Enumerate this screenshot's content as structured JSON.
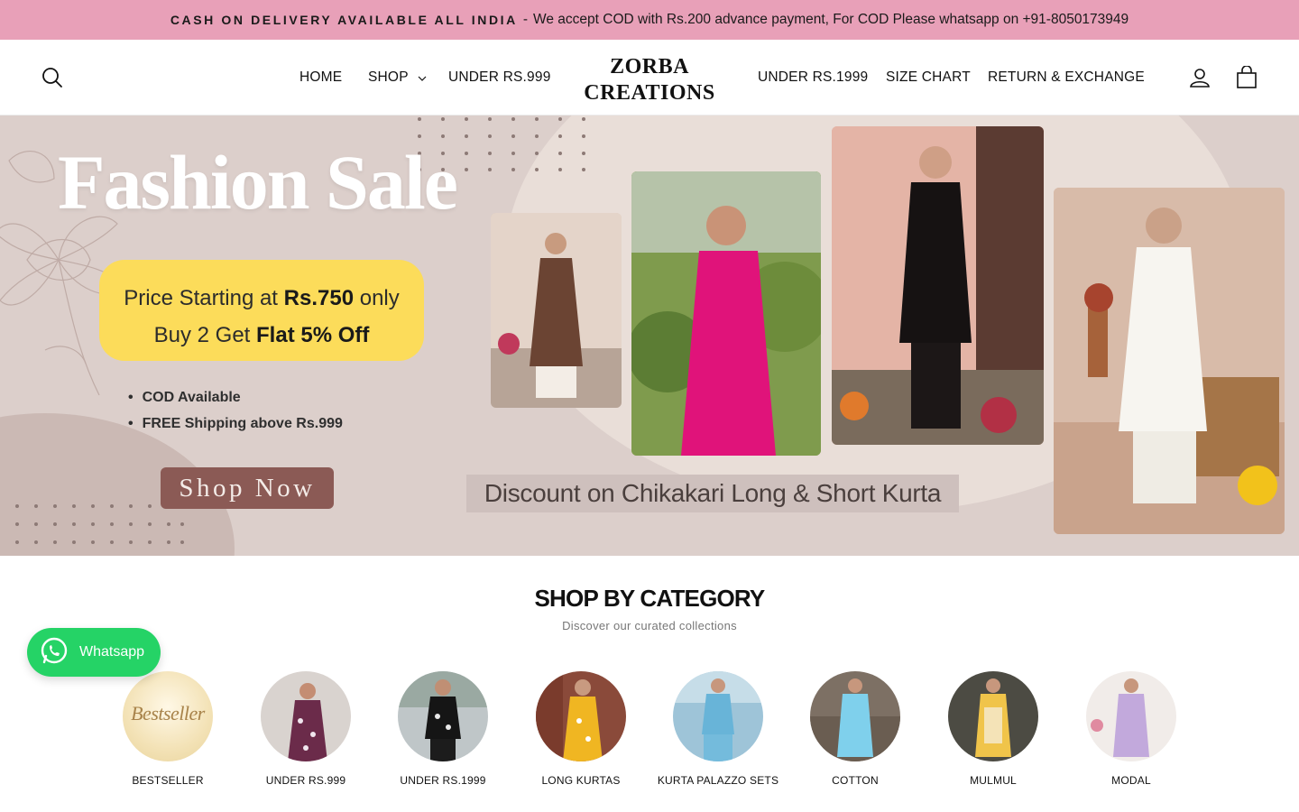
{
  "announcement": {
    "strong": "CASH ON DELIVERY AVAILABLE ALL INDIA",
    "separator": "-",
    "text": "We accept COD with Rs.200 advance payment, For COD Please whatsapp on +91-8050173949"
  },
  "header": {
    "logo_line1": "ZORBA",
    "logo_line2": "CREATIONS",
    "nav_left": [
      "HOME",
      "SHOP",
      "UNDER RS.999"
    ],
    "nav_right": [
      "UNDER RS.1999",
      "SIZE CHART",
      "RETURN & EXCHANGE"
    ],
    "icons": [
      "search-icon",
      "account-icon",
      "cart-icon",
      "chevron-down-icon"
    ]
  },
  "hero": {
    "title": "Fashion Sale",
    "price_line1_pre": "Price Starting at ",
    "price_line1_bold": "Rs.750",
    "price_line1_post": " only",
    "price_line2_pre": "Buy 2 Get ",
    "price_line2_bold": "Flat 5% Off",
    "bullets": [
      "COD Available",
      "FREE Shipping above Rs.999"
    ],
    "cta": "Shop Now",
    "discount": "Discount on Chikakari Long & Short Kurta"
  },
  "section": {
    "title": "SHOP BY CATEGORY",
    "subtitle": "Discover our curated collections"
  },
  "categories": [
    {
      "label": "BESTSELLER",
      "image_text": "Bestseller"
    },
    {
      "label": "UNDER RS.999"
    },
    {
      "label": "UNDER RS.1999"
    },
    {
      "label": "LONG KURTAS"
    },
    {
      "label": "KURTA PALAZZO SETS"
    },
    {
      "label": "COTTON"
    },
    {
      "label": "MULMUL"
    },
    {
      "label": "MODAL"
    }
  ],
  "whatsapp": {
    "label": "Whatsapp"
  },
  "colors": {
    "announce_bg": "#e8a0b8",
    "hero_bg": "#dccfcb",
    "price_box": "#fcdc5a",
    "cta_bg": "#8b5a55",
    "whatsapp": "#25d366"
  }
}
